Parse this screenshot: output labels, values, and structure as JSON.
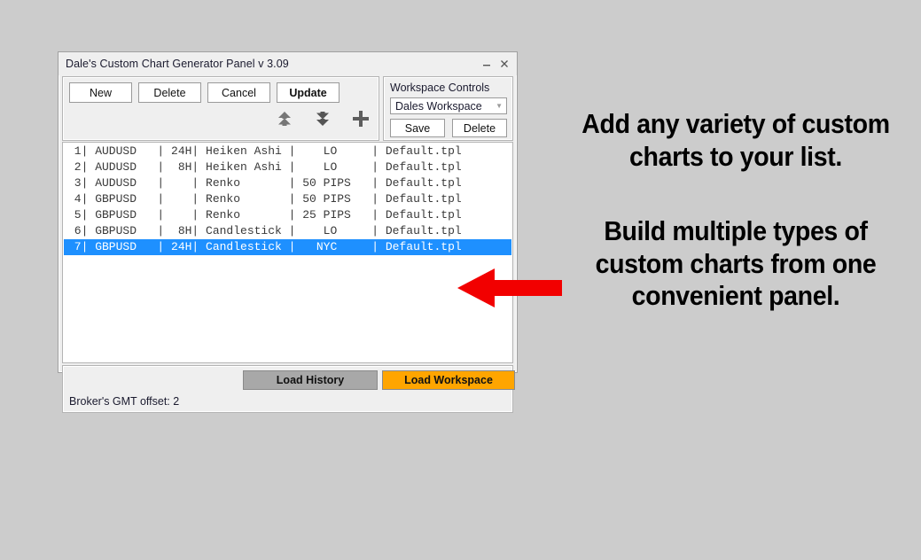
{
  "window": {
    "title": "Dale's Custom Chart Generator Panel v 3.09",
    "minimize_label": "minimize",
    "close_label": "close"
  },
  "toolbar": {
    "new_label": "New",
    "delete_label": "Delete",
    "cancel_label": "Cancel",
    "update_label": "Update",
    "icons": [
      {
        "name": "move-up-icon",
        "glyph": "double-chevron-up"
      },
      {
        "name": "move-down-icon",
        "glyph": "double-chevron-down"
      },
      {
        "name": "add-icon",
        "glyph": "plus"
      }
    ]
  },
  "workspace": {
    "title": "Workspace Controls",
    "selected_option": "Dales Workspace",
    "options": [
      "Dales Workspace"
    ],
    "save_label": "Save",
    "delete_label": "Delete"
  },
  "chart_list": {
    "columns": [
      "index",
      "symbol",
      "timeframe",
      "chart_type",
      "session_or_pips",
      "template"
    ],
    "rows": [
      {
        "index": "1",
        "symbol": "AUDUSD",
        "timeframe": "24H",
        "chart_type": "Heiken Ashi",
        "session_or_pips": "LO",
        "template": "Default.tpl",
        "selected": false,
        "text": " 1| AUDUSD   | 24H| Heiken Ashi |    LO     | Default.tpl"
      },
      {
        "index": "2",
        "symbol": "AUDUSD",
        "timeframe": "8H",
        "chart_type": "Heiken Ashi",
        "session_or_pips": "LO",
        "template": "Default.tpl",
        "selected": false,
        "text": " 2| AUDUSD   |  8H| Heiken Ashi |    LO     | Default.tpl"
      },
      {
        "index": "3",
        "symbol": "AUDUSD",
        "timeframe": "",
        "chart_type": "Renko",
        "session_or_pips": "50 PIPS",
        "template": "Default.tpl",
        "selected": false,
        "text": " 3| AUDUSD   |    | Renko       | 50 PIPS   | Default.tpl"
      },
      {
        "index": "4",
        "symbol": "GBPUSD",
        "timeframe": "",
        "chart_type": "Renko",
        "session_or_pips": "50 PIPS",
        "template": "Default.tpl",
        "selected": false,
        "text": " 4| GBPUSD   |    | Renko       | 50 PIPS   | Default.tpl"
      },
      {
        "index": "5",
        "symbol": "GBPUSD",
        "timeframe": "",
        "chart_type": "Renko",
        "session_or_pips": "25 PIPS",
        "template": "Default.tpl",
        "selected": false,
        "text": " 5| GBPUSD   |    | Renko       | 25 PIPS   | Default.tpl"
      },
      {
        "index": "6",
        "symbol": "GBPUSD",
        "timeframe": "8H",
        "chart_type": "Candlestick",
        "session_or_pips": "LO",
        "template": "Default.tpl",
        "selected": false,
        "text": " 6| GBPUSD   |  8H| Candlestick |    LO     | Default.tpl"
      },
      {
        "index": "7",
        "symbol": "GBPUSD",
        "timeframe": "24H",
        "chart_type": "Candlestick",
        "session_or_pips": "NYC",
        "template": "Default.tpl",
        "selected": true,
        "text": " 7| GBPUSD   | 24H| Candlestick |   NYC     | Default.tpl"
      }
    ],
    "selected_row_index": 7
  },
  "bottom": {
    "load_history_label": "Load History",
    "load_workspace_label": "Load Workspace",
    "status_text": "Broker's GMT offset: 2"
  },
  "promo": {
    "top_text": "Add any variety of custom charts to your list.",
    "bottom_text": "Build multiple types of custom charts from one convenient panel."
  },
  "colors": {
    "background": "#cccccc",
    "window_face": "#efefef",
    "selection_blue": "#1e90ff",
    "load_history_gray": "#a8a8a8",
    "load_workspace_orange": "#ffa500",
    "arrow_red": "#f20000"
  }
}
